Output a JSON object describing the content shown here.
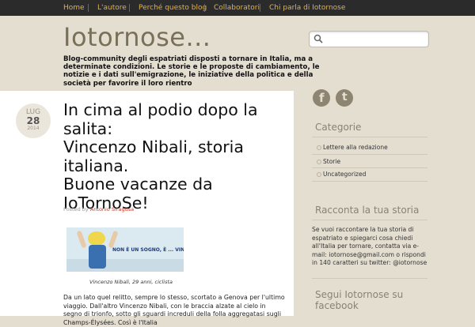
{
  "nav": {
    "items": [
      "Home",
      "L'autore",
      "Perché questo blog",
      "Collaboratori",
      "Chi parla di Iotornose"
    ]
  },
  "header": {
    "title": "Iotornose...",
    "tagline": "Blog-community degli espatriati disposti a tornare in Italia, ma a determinate condizioni. Le storie e le proposte di cambiamento, le notizie e i dati sull'emigrazione, le iniziative della politica e della società per favorire il loro rientro"
  },
  "search": {
    "placeholder": "",
    "icon": "search-icon"
  },
  "post": {
    "date": {
      "month": "LUG",
      "day": "28",
      "year": "2014"
    },
    "title_lines": [
      "In cima al podio dopo la",
      "salita:",
      "Vincenzo Nibali, storia",
      "italiana.",
      "Buone vacanze da",
      "IoTornoSe!"
    ],
    "byline_prefix": "Posted by",
    "author": "Antonio Siragusa",
    "photo_text": "NON È UN SOGNO, È ... VINTO DAVVERO.",
    "caption": "Vincenzo Nibali, 29 anni, ciclista",
    "body": "Da un lato quel relitto, sempre lo stesso, scortato a Genova per l'ultimo viaggio. Dall'altro Vincenzo Nibali, con le braccia alzate al cielo in segno di trionfo, sotto gli sguardi increduli della folla aggregatasi sugli Champs-Élysées. Così è l'Italia"
  },
  "sidebar": {
    "social": [
      {
        "icon": "facebook-icon",
        "glyph": "f"
      },
      {
        "icon": "twitter-icon",
        "glyph": "t"
      }
    ],
    "categories_title": "Categorie",
    "categories": [
      "Lettere alla redazione",
      "Storie",
      "Uncategorized"
    ],
    "story_title": "Racconta la tua storia",
    "story_text": "Se vuoi raccontare la tua storia di espatriato e spiegarci cosa chiedi all'Italia per tornare, contatta via e-mail: iotornose@gmail.com o rispondi in 140 caratteri su twitter: @iotornose",
    "follow_title_1": "Segui Iotornose su",
    "follow_title_2": "facebook"
  },
  "colors": {
    "nav_bg": "#2b2b2b",
    "nav_link": "#e3b14a",
    "accent": "#c0392b",
    "page_bg": "#e4ded0"
  }
}
